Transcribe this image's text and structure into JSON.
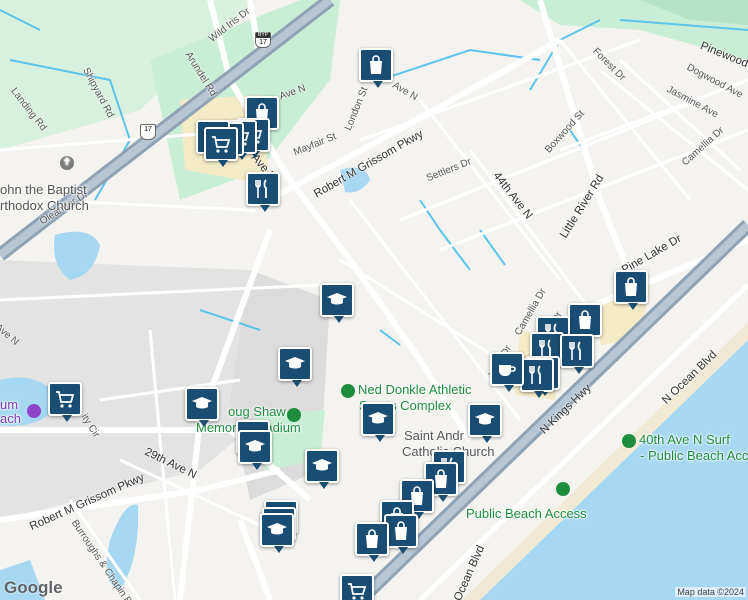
{
  "map": {
    "street_labels": [
      "Wild Iris Dr",
      "Arundel Rd",
      "Shipyard Rd",
      "Landing Rd",
      "Robert M Grissom Pkwy",
      "Mayfair St",
      "London St",
      "Ave N",
      "Settlers Dr",
      "Boxwood St",
      "44th Ave N",
      "Little River Rd",
      "Forest Dr",
      "Dogwood Ave",
      "Jasmine Ave",
      "Camellia Dr",
      "Pinewood",
      "Pine Lake Dr",
      "Camellia Dr",
      "N Kings Hwy",
      "N Ocean Blvd",
      "29th Ave N",
      "Robert M Grissom Pkwy",
      "Oleander Dr",
      "Burroughs & Chapin Blvd",
      "Ocean Blvd",
      "Ave N",
      "Oak Dr",
      "Ave N",
      "Lake Dr",
      "Ave N",
      "ity Cir"
    ],
    "poi_labels": {
      "church_john": [
        "ohn the Baptist",
        "rthodox Church"
      ],
      "ned_donkle": [
        "Ned Donkle Athletic",
        "Sports Complex"
      ],
      "doug_shaw": [
        "oug Shaw",
        "Memorial Stadium"
      ],
      "saint_andrew": [
        "Saint Andr",
        "Catholic Church"
      ],
      "beach_40th": [
        "40th Ave N Surf",
        "- Public Beach Acc"
      ],
      "public_beach": "Public Beach Access",
      "museum": [
        "um",
        "ach"
      ]
    },
    "route_shields": [
      {
        "label": "17",
        "top_label": "BYP"
      },
      {
        "label": "17",
        "top_label": ""
      }
    ],
    "marker_icons": [
      "shopping-bag-icon",
      "shopping-cart-icon",
      "restaurant-icon",
      "school-icon",
      "coffee-icon",
      "shopping-bag-icon"
    ],
    "colors": {
      "water": "#a7d8f2",
      "park": "#c9eed6",
      "highway": "#8fa3b5",
      "road": "#ffffff",
      "marker": "#1a4d73",
      "waterway": "#5cc4ea"
    }
  },
  "attribution": {
    "logo": "Google",
    "text": "Map data ©2024"
  }
}
